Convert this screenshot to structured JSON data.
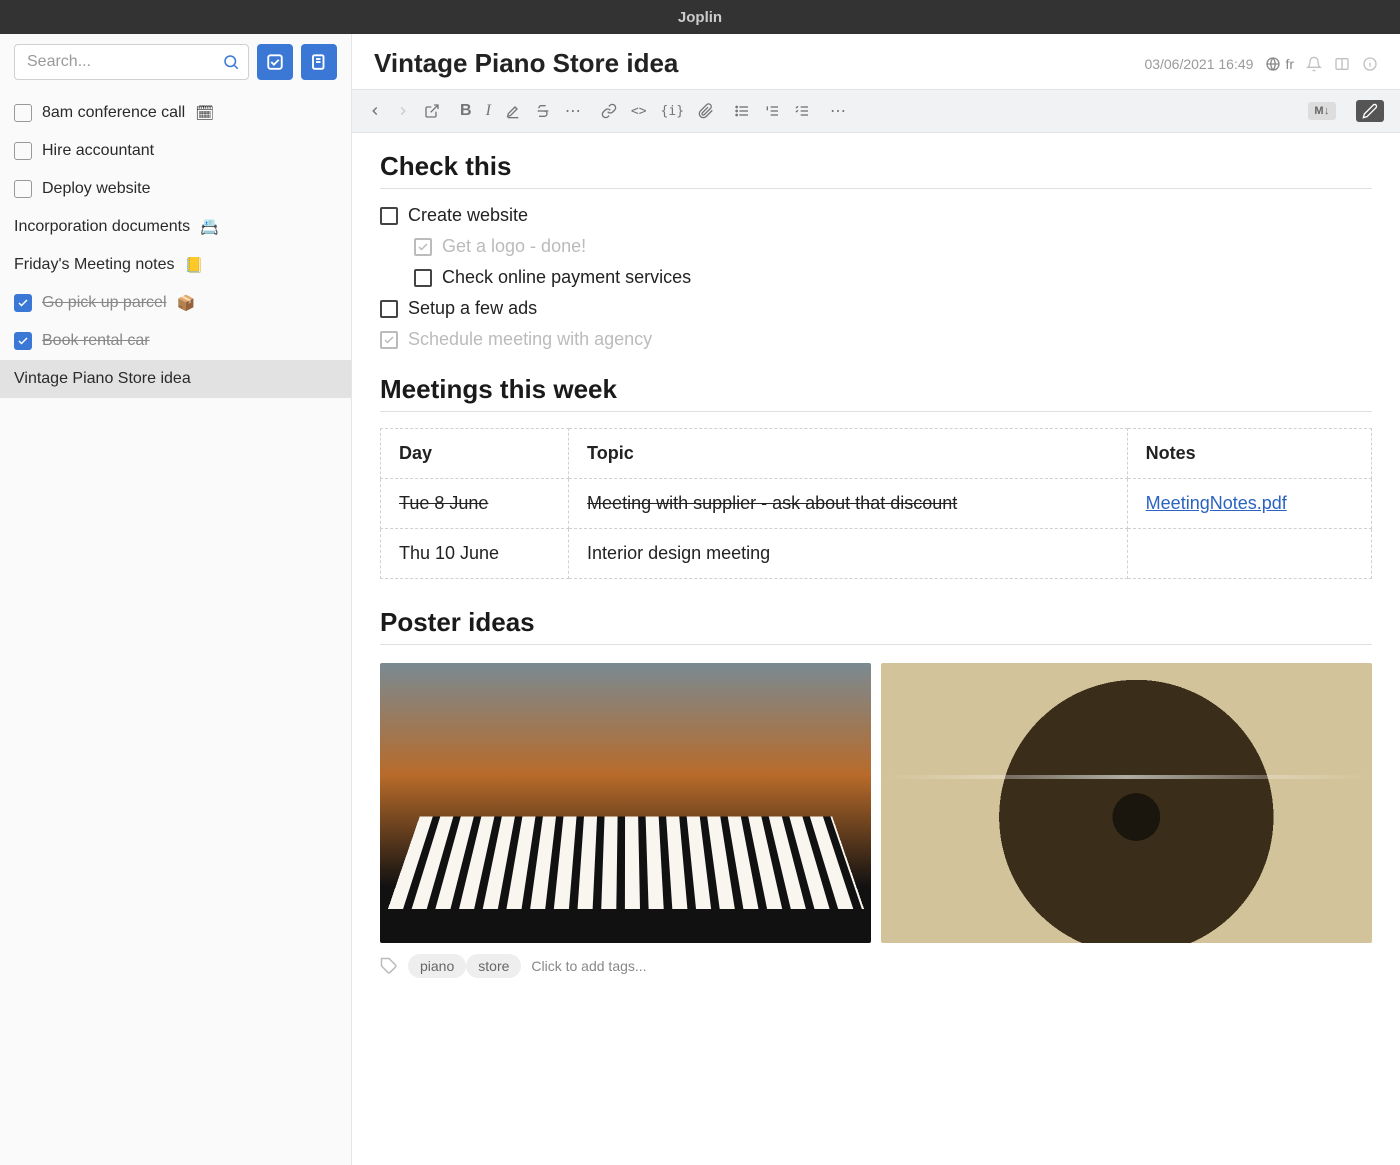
{
  "titlebar": "Joplin",
  "sidebar": {
    "search_placeholder": "Search...",
    "items": [
      {
        "label": "8am conference call",
        "checked": false,
        "has_checkbox": true,
        "emoji": "🗓"
      },
      {
        "label": "Hire accountant",
        "checked": false,
        "has_checkbox": true,
        "emoji": ""
      },
      {
        "label": "Deploy website",
        "checked": false,
        "has_checkbox": true,
        "emoji": ""
      },
      {
        "label": "Incorporation documents",
        "checked": false,
        "has_checkbox": false,
        "emoji": "📇"
      },
      {
        "label": "Friday's Meeting notes",
        "checked": false,
        "has_checkbox": false,
        "emoji": "📒"
      },
      {
        "label": "Go pick up parcel",
        "checked": true,
        "has_checkbox": true,
        "emoji": "📦"
      },
      {
        "label": "Book rental car",
        "checked": true,
        "has_checkbox": true,
        "emoji": ""
      },
      {
        "label": "Vintage Piano Store idea",
        "checked": false,
        "has_checkbox": false,
        "emoji": "",
        "selected": true
      }
    ]
  },
  "note": {
    "title": "Vintage Piano Store idea",
    "timestamp": "03/06/2021 16:49",
    "lang": "fr",
    "sections": {
      "check_this": {
        "heading": "Check this",
        "items": [
          {
            "text": "Create website",
            "checked": false,
            "level": 0
          },
          {
            "text": "Get a logo - done!",
            "checked": true,
            "level": 1
          },
          {
            "text": "Check online payment services",
            "checked": false,
            "level": 1
          },
          {
            "text": "Setup a few ads",
            "checked": false,
            "level": 0
          },
          {
            "text": "Schedule meeting with agency",
            "checked": true,
            "level": 0
          }
        ]
      },
      "meetings": {
        "heading": "Meetings this week",
        "columns": [
          "Day",
          "Topic",
          "Notes"
        ],
        "rows": [
          {
            "day": "Tue 8 June",
            "topic": "Meeting with supplier - ask about that discount",
            "notes": "MeetingNotes.pdf",
            "strike": true,
            "link": true
          },
          {
            "day": "Thu 10 June",
            "topic": "Interior design meeting",
            "notes": "",
            "strike": false,
            "link": false
          }
        ]
      },
      "posters": {
        "heading": "Poster ideas"
      }
    }
  },
  "tags": {
    "items": [
      "piano",
      "store"
    ],
    "placeholder": "Click to add tags..."
  },
  "toolbar": {
    "md_label": "M↓"
  }
}
